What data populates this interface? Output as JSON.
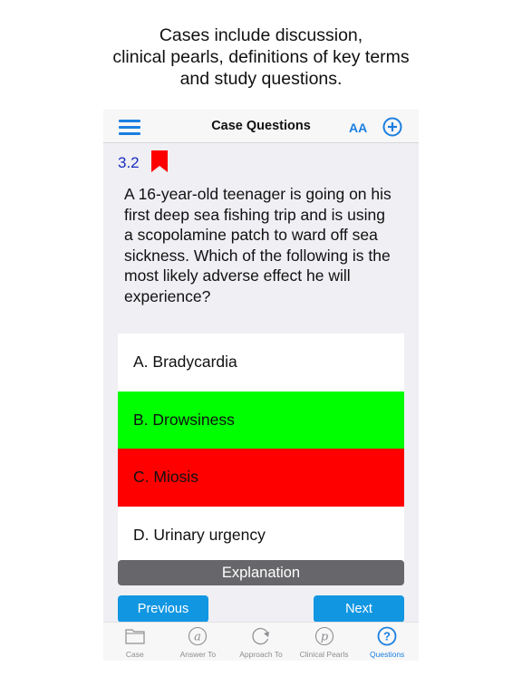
{
  "caption": {
    "lines": [
      "Cases include discussion,",
      "clinical pearls, definitions of key terms",
      "and study questions."
    ]
  },
  "navbar": {
    "menu_icon": "hamburger-icon",
    "title": "Case Questions",
    "font_size_label": "AA",
    "add_icon": "plus-circle-icon"
  },
  "question": {
    "number": "3.2",
    "bookmarked": true,
    "bookmark_color": "#ff0000",
    "text": "A 16-year-old teenager is going on his first deep sea fishing trip and is using a scopolamine patch to ward off sea sickness. Which of the following is the most likely adverse effect he will experience?"
  },
  "answers": [
    {
      "label": "A. Bradycardia",
      "state": "neutral",
      "color": "#ffffff"
    },
    {
      "label": "B. Drowsiness",
      "state": "correct",
      "color": "#00ff00"
    },
    {
      "label": "C. Miosis",
      "state": "incorrect",
      "color": "#ff0000"
    },
    {
      "label": "D. Urinary urgency",
      "state": "neutral",
      "color": "#ffffff"
    }
  ],
  "buttons": {
    "explanation": "Explanation",
    "previous": "Previous",
    "next": "Next"
  },
  "tabbar": {
    "active_color": "#1b7fe0",
    "tabs": [
      {
        "label": "Case",
        "icon": "folder-icon",
        "active": false
      },
      {
        "label": "Answer To",
        "icon": "at-sign-icon",
        "active": false
      },
      {
        "label": "Approach To",
        "icon": "refresh-arrow-icon",
        "active": false
      },
      {
        "label": "Clinical Pearls",
        "icon": "p-circle-icon",
        "active": false
      },
      {
        "label": "Questions",
        "icon": "question-circle-icon",
        "active": true
      }
    ]
  }
}
